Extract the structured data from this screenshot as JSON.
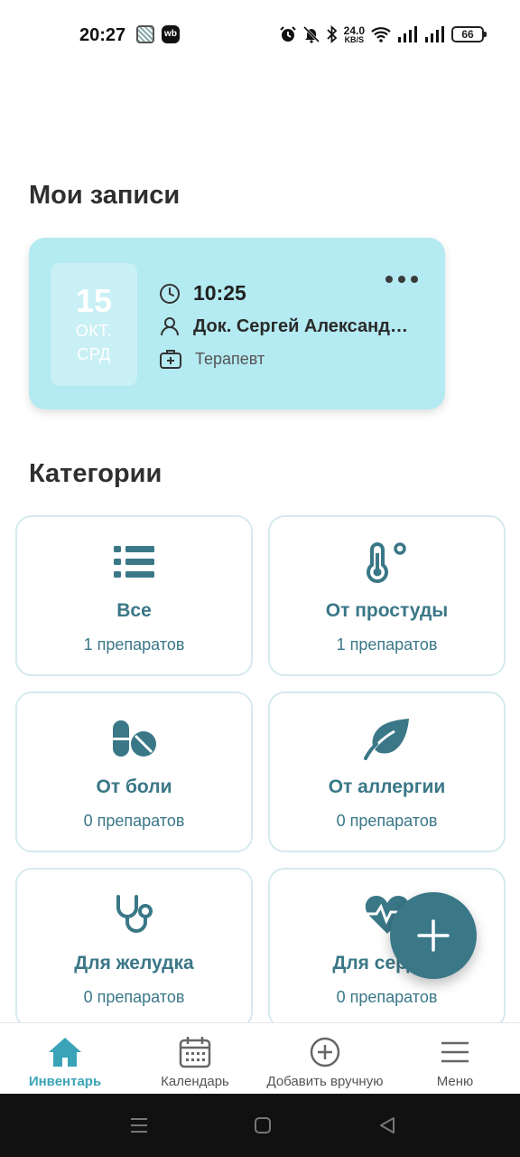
{
  "status_bar": {
    "time": "20:27",
    "net_speed": "24.0",
    "net_unit": "KB/S",
    "battery": "66",
    "icons": [
      "qr-app-icon",
      "wb-app-icon",
      "alarm-icon",
      "mute-icon",
      "bluetooth-icon",
      "wifi-icon",
      "signal-icon",
      "battery-icon"
    ],
    "wb_label": "wb"
  },
  "appointments": {
    "title": "Мои записи",
    "card": {
      "day": "15",
      "month": "ОКТ.",
      "weekday": "СРД",
      "time": "10:25",
      "doctor": "Док. Сергей Александрович",
      "specialty": "Терапевт"
    }
  },
  "categories": {
    "title": "Категории",
    "items": [
      {
        "name": "Все",
        "count": "1 препаратов",
        "icon": "list-icon"
      },
      {
        "name": "От простуды",
        "count": "1 препаратов",
        "icon": "thermometer-icon"
      },
      {
        "name": "От боли",
        "count": "0 препаратов",
        "icon": "pills-icon"
      },
      {
        "name": "От аллергии",
        "count": "0 препаратов",
        "icon": "leaf-icon"
      },
      {
        "name": "Для желудка",
        "count": "0 препаратов",
        "icon": "stethoscope-icon"
      },
      {
        "name": "Для сердца",
        "count": "0 препаратов",
        "icon": "heartbeat-icon"
      }
    ]
  },
  "fab": {
    "icon": "plus-icon"
  },
  "bottom_nav": {
    "items": [
      {
        "label": "Инвентарь",
        "icon": "home-icon",
        "active": true
      },
      {
        "label": "Календарь",
        "icon": "calendar-icon",
        "active": false
      },
      {
        "label": "Добавить вручную",
        "icon": "add-circle-icon",
        "active": false
      },
      {
        "label": "Меню",
        "icon": "menu-icon",
        "active": false
      }
    ]
  },
  "colors": {
    "accent": "#3a7787",
    "card_bg": "#b4eaf1",
    "active_nav": "#3aa3b8"
  }
}
